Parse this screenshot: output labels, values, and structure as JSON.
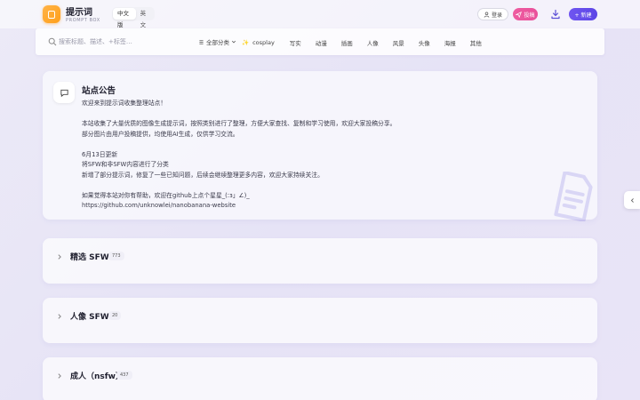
{
  "header": {
    "app_title": "提示词",
    "app_subtitle": "PROMPT BOX",
    "lang_options": [
      "中文版",
      "英文"
    ],
    "login_label": "登录",
    "submit_label": "投稿",
    "new_label": "+ 新建"
  },
  "search": {
    "placeholder": "搜索标题、描述、+标签…",
    "category_label": "全部分类",
    "tags": [
      "cosplay",
      "写实",
      "动漫",
      "插画",
      "人像",
      "风景",
      "头像",
      "海报",
      "其他"
    ]
  },
  "notice": {
    "title": "站点公告",
    "lines": [
      "欢迎来到提示词收集整理站点！",
      "",
      "本站收集了大量优质的图像生成提示词，按照类别进行了整理，方便大家查找、复制和学习使用，欢迎大家投稿分享。",
      "部分图片由用户投稿提供，均使用AI生成，仅供学习交流。",
      "",
      "6月13日更新",
      "将SFW和非SFW内容进行了分类",
      "新增了部分提示词，修复了一些已知问题，后续会继续整理更多内容，欢迎大家持续关注。",
      "",
      "如果觉得本站对你有帮助，欢迎在github上点个星星_(:з」∠)_",
      "https://github.com/unknowlei/nanobanana-website"
    ]
  },
  "sections": [
    {
      "title": "精选 SFW",
      "count": "773"
    },
    {
      "title": "人像 SFW",
      "count": "20"
    },
    {
      "title": "成人（nsfw）",
      "count": "437"
    }
  ],
  "colors": {
    "accent": "#5c45e6",
    "submit": "#e94f9a",
    "logo": "#ff9f1a"
  }
}
